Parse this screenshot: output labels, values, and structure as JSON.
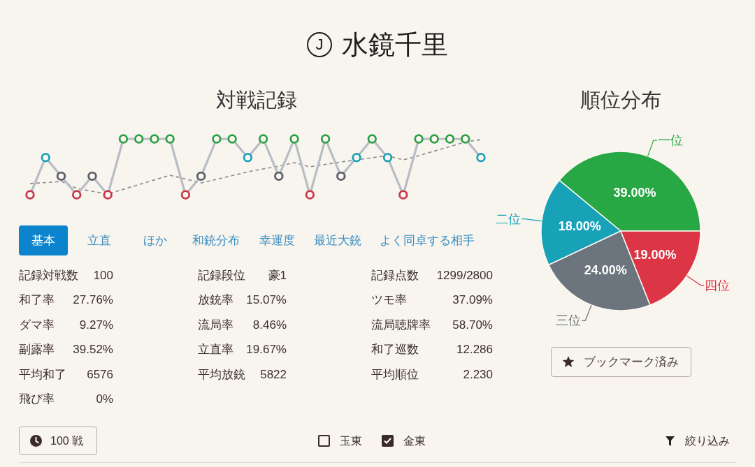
{
  "header": {
    "badge": "J",
    "name": "水鏡千里"
  },
  "match_record": {
    "title": "対戦記録"
  },
  "tabs": [
    {
      "label": "基本",
      "selected": true
    },
    {
      "label": "立直",
      "selected": false
    },
    {
      "label": "ほか",
      "selected": false
    },
    {
      "label": "和銃分布",
      "selected": false
    },
    {
      "label": "幸運度",
      "selected": false
    },
    {
      "label": "最近大銃",
      "selected": false
    },
    {
      "label": "よく同卓する相手",
      "selected": false
    }
  ],
  "stat_columns": [
    [
      {
        "label": "記録対戦数",
        "value": "100"
      },
      {
        "label": "和了率",
        "value": "27.76%"
      },
      {
        "label": "ダマ率",
        "value": "9.27%"
      },
      {
        "label": "副露率",
        "value": "39.52%"
      },
      {
        "label": "平均和了",
        "value": "6576"
      },
      {
        "label": "飛び率",
        "value": "0%"
      }
    ],
    [
      {
        "label": "記録段位",
        "value": "豪1"
      },
      {
        "label": "放銃率",
        "value": "15.07%"
      },
      {
        "label": "流局率",
        "value": "8.46%"
      },
      {
        "label": "立直率",
        "value": "19.67%"
      },
      {
        "label": "平均放銃",
        "value": "5822"
      }
    ],
    [
      {
        "label": "記録点数",
        "value": "1299/2800"
      },
      {
        "label": "ツモ率",
        "value": "37.09%"
      },
      {
        "label": "流局聴牌率",
        "value": "58.70%"
      },
      {
        "label": "和了巡数",
        "value": "12.286"
      },
      {
        "label": "平均順位",
        "value": "2.230"
      }
    ]
  ],
  "rank_distribution": {
    "chart_data": {
      "type": "pie",
      "title": "順位分布",
      "categories": [
        "一位",
        "二位",
        "三位",
        "四位"
      ],
      "values": [
        39,
        18,
        24,
        19
      ],
      "value_labels": [
        "39.00%",
        "18.00%",
        "24.00%",
        "19.00%"
      ]
    }
  },
  "bookmark_button": {
    "label": "ブックマーク済み"
  },
  "footer": {
    "games_button": {
      "label": "100 戦"
    },
    "room_filters": [
      {
        "label": "玉東",
        "checked": false
      },
      {
        "label": "金東",
        "checked": true
      }
    ],
    "filter_button": {
      "label": "絞り込み"
    }
  }
}
